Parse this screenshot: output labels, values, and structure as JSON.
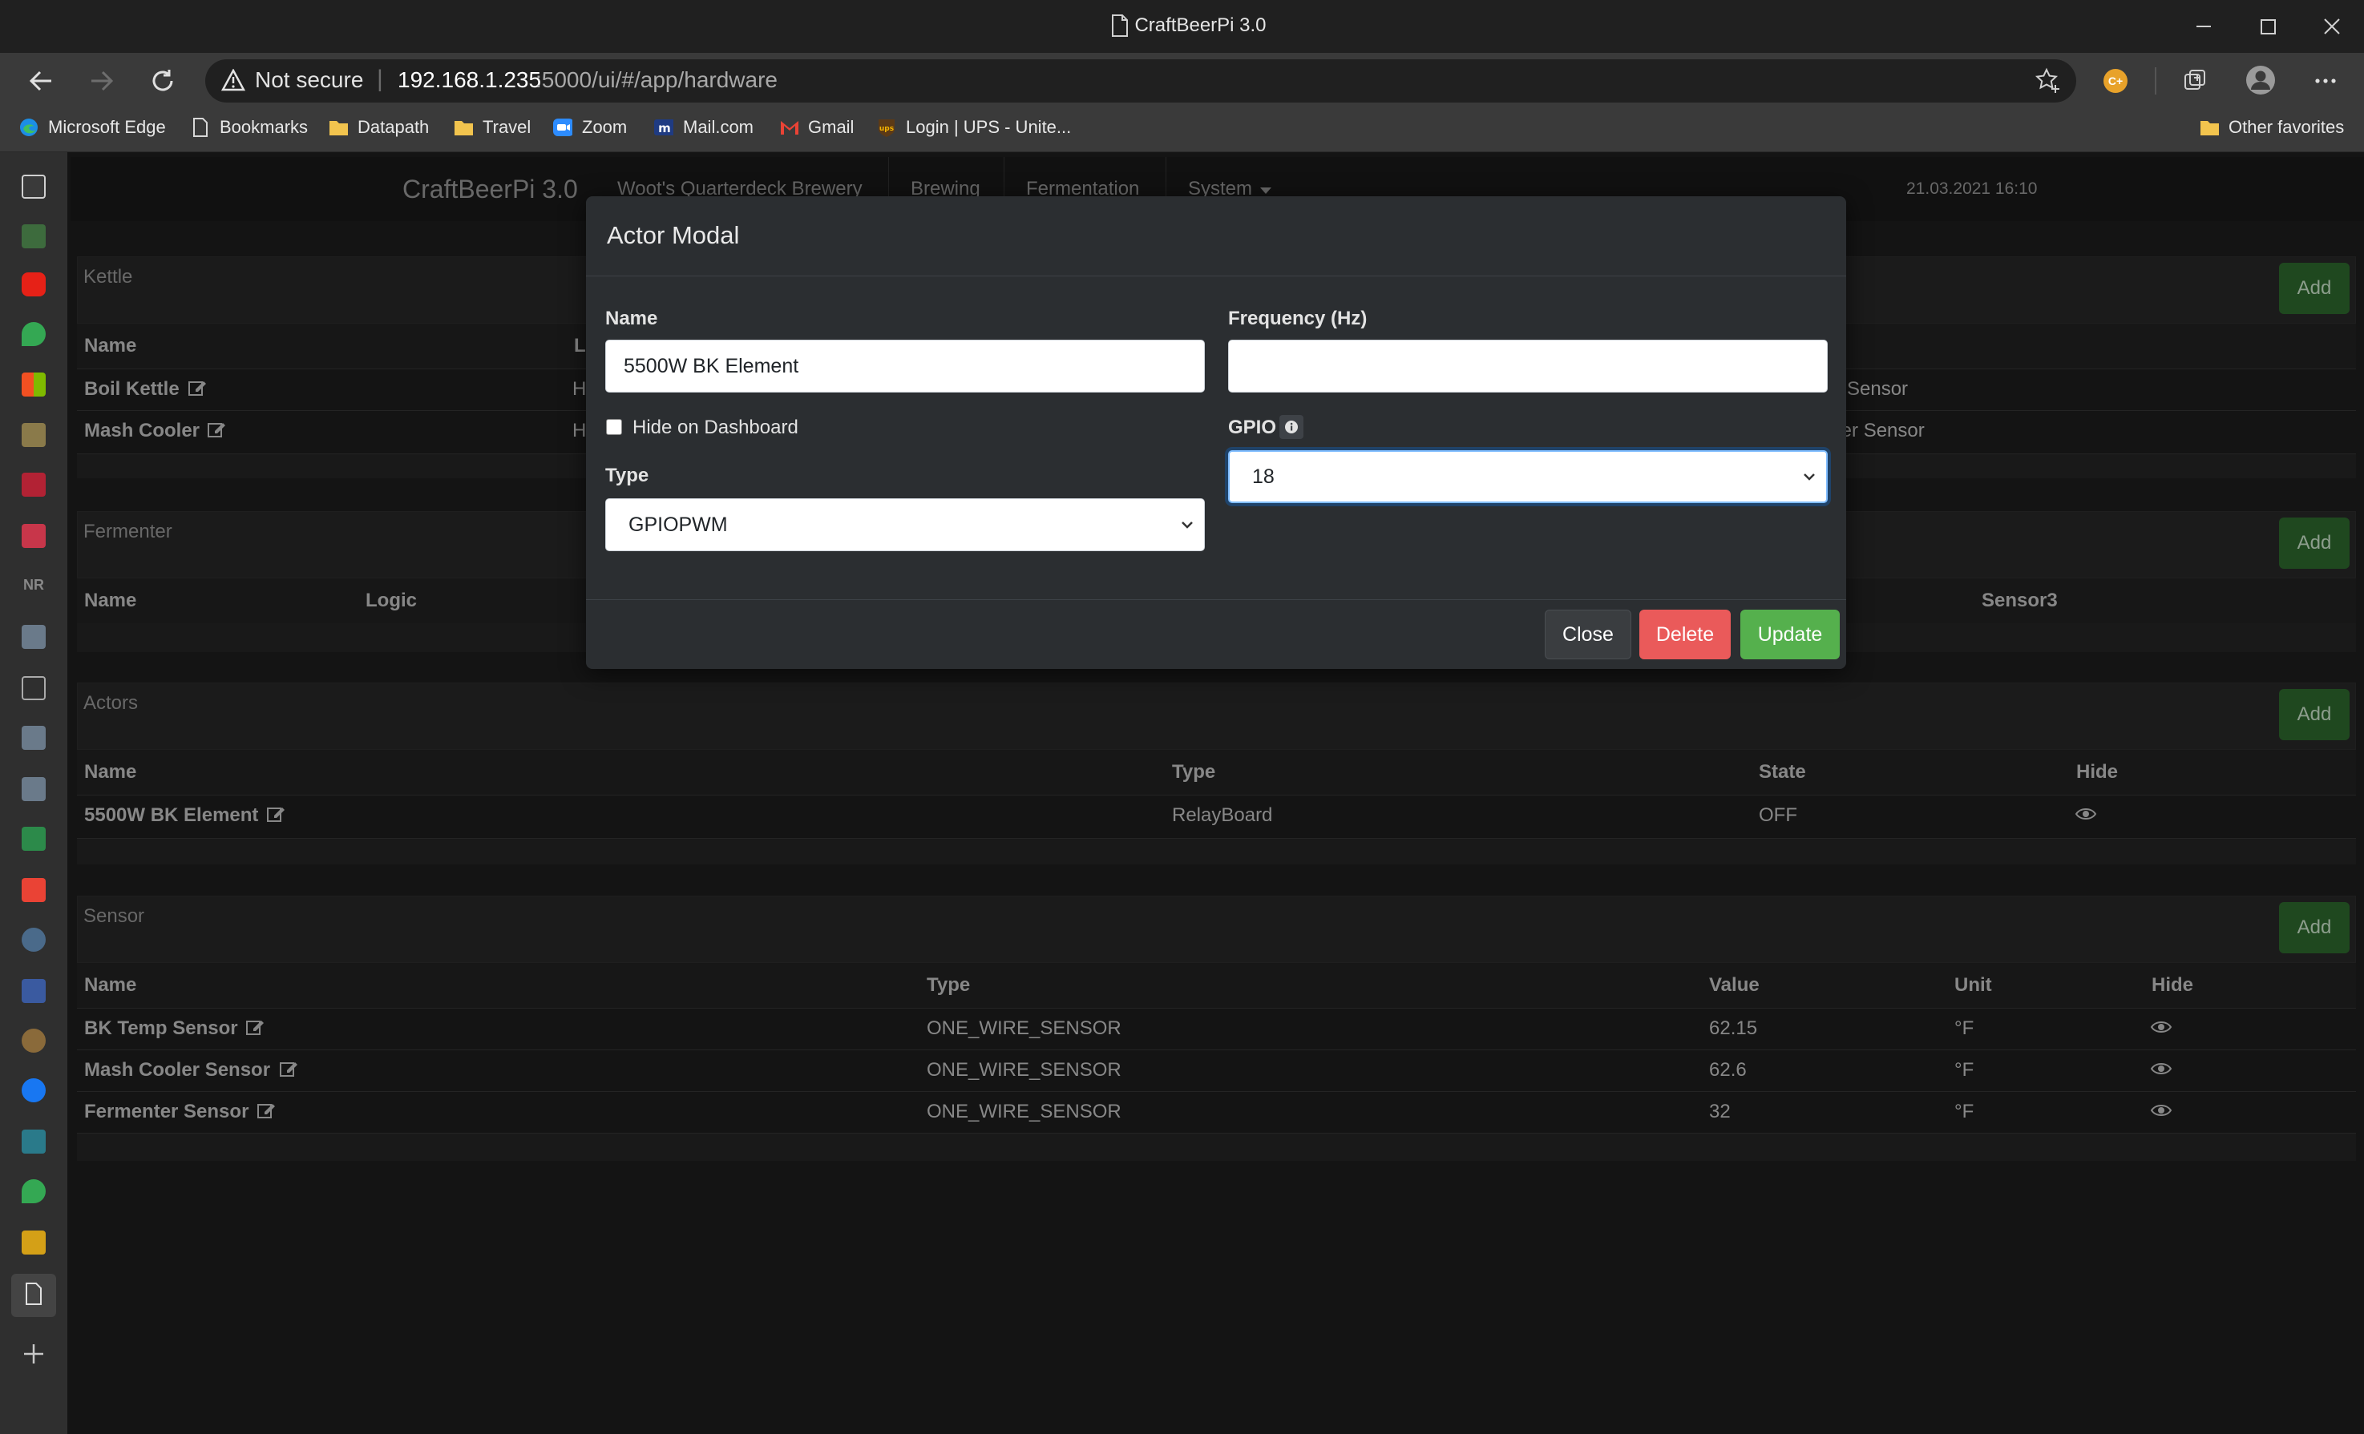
{
  "window": {
    "title": "CraftBeerPi 3.0"
  },
  "addressbar": {
    "security": "Not secure",
    "host": "192.168.1.235",
    "path": ":5000/ui/#/app/hardware"
  },
  "favorites": [
    {
      "label": "Microsoft Edge",
      "icon": "edge-icon"
    },
    {
      "label": "Bookmarks",
      "icon": "page-icon"
    },
    {
      "label": "Datapath",
      "icon": "folder-icon"
    },
    {
      "label": "Travel",
      "icon": "folder-icon"
    },
    {
      "label": "Zoom",
      "icon": "zoom-icon"
    },
    {
      "label": "Mail.com",
      "icon": "mailcom-icon"
    },
    {
      "label": "Gmail",
      "icon": "gmail-icon"
    },
    {
      "label": "Login | UPS - Unite...",
      "icon": "ups-icon"
    }
  ],
  "other_favorites": "Other favorites",
  "app": {
    "brand": "CraftBeerPi 3.0",
    "nav": [
      "Woot's Quarterdeck Brewery",
      "Brewing",
      "Fermentation",
      "System"
    ],
    "datetime": "21.03.2021 16:10",
    "add_label": "Add"
  },
  "kettle": {
    "title": "Kettle",
    "col_name": "Name",
    "col_logic_partial": "L",
    "rows": [
      {
        "name": "Boil Kettle",
        "logic_partial": "H",
        "sensor_partial": "Sensor"
      },
      {
        "name": "Mash Cooler",
        "logic_partial": "H",
        "sensor_partial": "oler Sensor"
      }
    ]
  },
  "fermenter": {
    "title": "Fermenter",
    "cols": [
      "Name",
      "Logic",
      "Sensor3"
    ]
  },
  "actors": {
    "title": "Actors",
    "cols": [
      "Name",
      "Type",
      "State",
      "Hide"
    ],
    "rows": [
      {
        "name": "5500W BK Element",
        "type": "RelayBoard",
        "state": "OFF"
      }
    ]
  },
  "sensor": {
    "title": "Sensor",
    "cols": [
      "Name",
      "Type",
      "Value",
      "Unit",
      "Hide"
    ],
    "rows": [
      {
        "name": "BK Temp Sensor",
        "type": "ONE_WIRE_SENSOR",
        "value": "62.15",
        "unit": "°F"
      },
      {
        "name": "Mash Cooler Sensor",
        "type": "ONE_WIRE_SENSOR",
        "value": "62.6",
        "unit": "°F"
      },
      {
        "name": "Fermenter Sensor",
        "type": "ONE_WIRE_SENSOR",
        "value": "32",
        "unit": "°F"
      }
    ]
  },
  "modal": {
    "title": "Actor Modal",
    "name_label": "Name",
    "name_value": "5500W BK Element",
    "hide_label": "Hide on Dashboard",
    "hide_checked": false,
    "type_label": "Type",
    "type_value": "GPIOPWM",
    "freq_label": "Frequency (Hz)",
    "freq_value": "",
    "gpio_label": "GPIO",
    "gpio_value": "18",
    "close": "Close",
    "delete": "Delete",
    "update": "Update"
  }
}
